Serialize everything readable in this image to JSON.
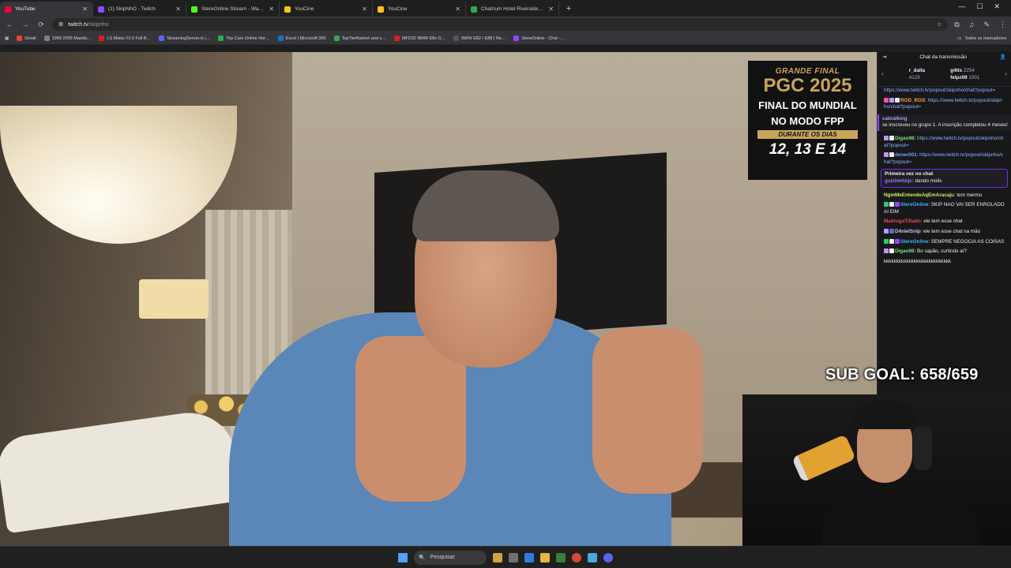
{
  "browser": {
    "tabs": [
      {
        "title": "YouTube",
        "color": "#ff0033",
        "active": true
      },
      {
        "title": "(1) SkipNhO - Twitch",
        "color": "#9147ff",
        "active": false
      },
      {
        "title": "StereOnline Stream - Watch Li…",
        "color": "#53fc18",
        "active": false
      },
      {
        "title": "YouCine",
        "color": "#f5c518",
        "active": false
      },
      {
        "title": "YouCine",
        "color": "#f5c518",
        "active": false
      },
      {
        "title": "Chatrium Hotel Riverside Bang…",
        "color": "#34a853",
        "active": false
      }
    ],
    "url_host": "twitch.tv",
    "url_path": "/skipnho",
    "bookmarks": [
      {
        "label": "Gmail",
        "color": "#ea4335"
      },
      {
        "label": "1989-2005 Mazda…",
        "color": "#7f7f7f"
      },
      {
        "label": "LS Miata V2.0 Full B…",
        "color": "#e11b22"
      },
      {
        "label": "StreamingServer.io |…",
        "color": "#5865f2"
      },
      {
        "label": "Top Cars Online Hor…",
        "color": "#34a853"
      },
      {
        "label": "Excel | Microsoft 365",
        "color": "#1f6fd1"
      },
      {
        "label": "TopTierRamen and s…",
        "color": "#34a853"
      },
      {
        "label": "MFD32 BMW E8x G…",
        "color": "#e11b22"
      },
      {
        "label": "BMW E82 / E88 | No…",
        "color": "#555"
      },
      {
        "label": "StereOnline - Chat -…",
        "color": "#9147ff"
      }
    ],
    "bookmarks_all": "Todos os marcadores"
  },
  "stream": {
    "promo": {
      "top": "GRANDE FINAL",
      "brand": "PGC 2025",
      "line1": "FINAL DO MUNDIAL",
      "line2": "NO MODO FPP",
      "band": "DURANTE OS DIAS",
      "dates": "12, 13 E 14"
    },
    "sub_goal": "SUB GOAL: 658/659"
  },
  "chat": {
    "title": "Chat da transmissão",
    "gifters": [
      {
        "name": "r_dalla",
        "value": "4129"
      },
      {
        "name": "g4tts",
        "value": "2254"
      },
      {
        "name": "felpz09",
        "value": "1001"
      }
    ],
    "messages": [
      {
        "user": "",
        "color": "#8cb8ff",
        "text": "https://www.twitch.tv/popout/skipnho/chat?popout=",
        "link": true,
        "badges": []
      },
      {
        "user": "ROD_ROS",
        "color": "#f2a33a",
        "text": "https://www.twitch.tv/popout/skipnho/chat?popout=",
        "link": true,
        "badges": [
          "#ff4fa3",
          "#bf94ff",
          "#efeff1"
        ]
      },
      {
        "user": "cabralking",
        "color": "#bf94ff",
        "text": "se inscreveu no grupo 1. A inscrição completou 4 meses!",
        "link": false,
        "system": true,
        "badges": []
      },
      {
        "user": "Digao98",
        "color": "#6ee37a",
        "text": "https://www.twitch.tv/popout/skipnho/chat?popout=",
        "link": true,
        "badges": [
          "#bf94ff",
          "#efeff1"
        ]
      },
      {
        "user": "dener001",
        "color": "#6ea6ff",
        "text": "https://www.twitch.tv/popout/skipnho/chat?popout=",
        "link": true,
        "badges": [
          "#bf94ff",
          "#efeff1"
        ]
      },
      {
        "user": "NgmMeEntendeAqEmAracaju",
        "color": "#c6f05c",
        "text": "tem mermo",
        "link": false,
        "badges": []
      },
      {
        "user": "StereOnline",
        "color": "#37b6ff",
        "text": "SKIP NAO VAI SER ENROLADO AI EIM",
        "link": false,
        "badges": [
          "#2ecc71",
          "#efeff1",
          "#9147ff"
        ]
      },
      {
        "user": "MadrugaTiltado",
        "color": "#e34a4a",
        "text": "ele tem esse chat",
        "link": false,
        "badges": []
      },
      {
        "user": "D4nielSnlp",
        "color": "#c7c7ff",
        "text": "ele tem esse chat na mão",
        "link": false,
        "badges": [
          "#bf94ff",
          "#5c6bc0"
        ]
      },
      {
        "user": "StereOnline",
        "color": "#37b6ff",
        "text": "SEMPRE NEGOCIA AS COISAS",
        "link": false,
        "badges": [
          "#2ecc71",
          "#efeff1",
          "#9147ff"
        ]
      },
      {
        "user": "Digao98",
        "color": "#6ee37a",
        "text": "Bo sapão, curtindo aí?",
        "link": false,
        "badges": [
          "#bf94ff",
          "#efeff1"
        ]
      },
      {
        "user": "",
        "color": "#efeff1",
        "text": "kkkkkkkkkkkkkkkkkkkkkkkkkkk",
        "link": false,
        "badges": []
      }
    ],
    "first_msg": {
      "header": "Primeira vez no chat",
      "user": "guizinnhbjc",
      "text": "dando molis"
    }
  },
  "taskbar": {
    "search_placeholder": "Pesquisar"
  }
}
